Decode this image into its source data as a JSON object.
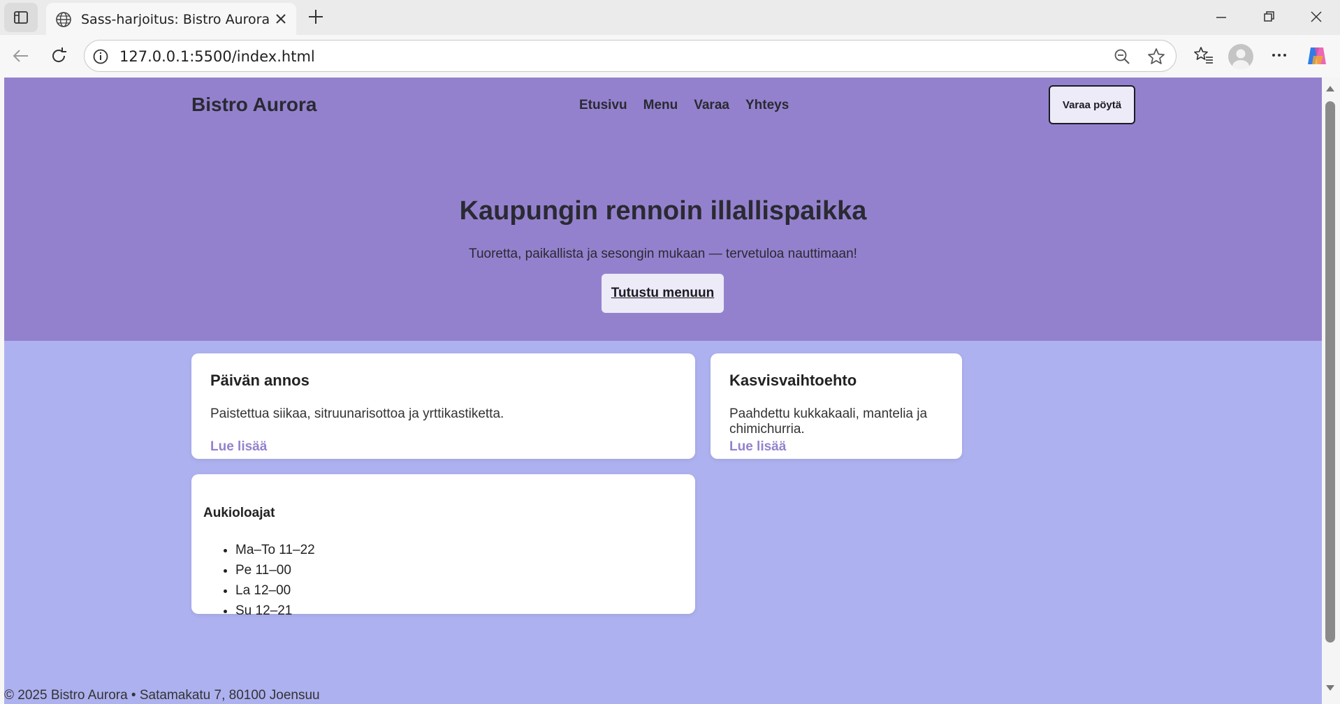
{
  "browser": {
    "tab_title": "Sass-harjoitus: Bistro Aurora",
    "url": "127.0.0.1:5500/index.html"
  },
  "site": {
    "brand": "Bistro Aurora",
    "nav": [
      "Etusivu",
      "Menu",
      "Varaa",
      "Yhteys"
    ],
    "cta_label": "Varaa pöytä"
  },
  "hero": {
    "title": "Kaupungin rennoin illallispaikka",
    "subtitle": "Tuoretta, paikallista ja sesongin mukaan — tervetuloa nauttimaan!",
    "button_label": "Tutustu menuun"
  },
  "cards": [
    {
      "title": "Päivän annos",
      "text": "Paistettua siikaa, sitruunarisottoa ja yrttikastiketta.",
      "link": "Lue lisää"
    },
    {
      "title": "Kasvisvaihtoehto",
      "text": "Paahdettu kukkakaali, mantelia ja chimichurria.",
      "link": "Lue lisää"
    }
  ],
  "hours": {
    "title": "Aukioloajat",
    "items": [
      "Ma–To 11–22",
      "Pe 11–00",
      "La 12–00",
      "Su 12–21"
    ]
  },
  "footer": {
    "text": "© 2025 Bistro Aurora • Satamakatu 7, 80100 Joensuu"
  },
  "colors": {
    "header_bg": "#9481ce",
    "page_bg": "#adb1ef",
    "card_bg": "#ffffff",
    "link": "#9481ce"
  }
}
